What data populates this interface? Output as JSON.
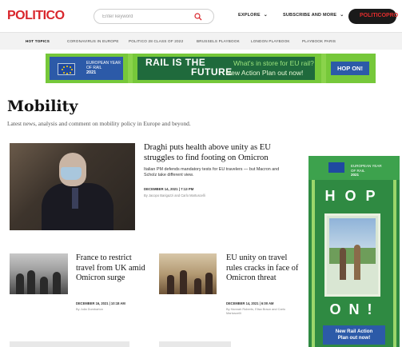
{
  "header": {
    "logo": "POLITICO",
    "search_placeholder": "Enter keyword",
    "nav": [
      {
        "label": "EXPLORE"
      },
      {
        "label": "SUBSCRIBE AND MORE"
      }
    ],
    "pro_label": "POLITICOPRO"
  },
  "topics": [
    "HOT TOPICS",
    "CORONAVIRUS IN EUROPE",
    "POLITICO 28 CLASS OF 2022",
    "BRUSSELS PLAYBOOK",
    "LONDON PLAYBOOK",
    "PLAYBOOK PARIS"
  ],
  "banner_ad": {
    "eu_line1": "EUROPEAN YEAR",
    "eu_line2": "OF RAIL",
    "eu_year": "2021",
    "rail": "RAIL IS THE",
    "future": "FUTURE",
    "tagline1": "What's in store for EU rail?",
    "tagline2": "New Action Plan out now!",
    "cta": "HOP ON!"
  },
  "page": {
    "title": "Mobility",
    "description": "Latest news, analysis and comment on mobility policy in Europe and beyond."
  },
  "lead_story": {
    "title": "Draghi puts health above unity as EU struggles to find footing on Omicron",
    "summary": "Italian PM defends mandatory tests for EU travelers — but Macron and Scholz take different view.",
    "date": "DECEMBER 14, 2021 | 7:13 PM",
    "byline": "By Jacopo Barigazzi and Carlo Martuscelli"
  },
  "stories": [
    {
      "title": "France to restrict travel from UK amid Omicron surge",
      "date": "DECEMBER 16, 2021 | 10:18 AM",
      "byline": "By Julia Dumbarton"
    },
    {
      "title": "EU unity on travel rules cracks in face of Omicron threat",
      "date": "DECEMBER 14, 2021 | 6:00 AM",
      "byline": "By Hannah Roberts, Elisa Braun and Carlo Martuscelli"
    }
  ],
  "side_ad": {
    "eu_line1": "EUROPEAN YEAR",
    "eu_line2": "OF RAIL",
    "eu_year": "2021",
    "hop": "HOP",
    "on": "ON!",
    "cta_line1": "New Rail Action",
    "cta_line2": "Plan out now!"
  },
  "colors": {
    "brand_red": "#d9262c",
    "ad_green": "#76c83a",
    "ad_blue": "#2c5aa8"
  }
}
